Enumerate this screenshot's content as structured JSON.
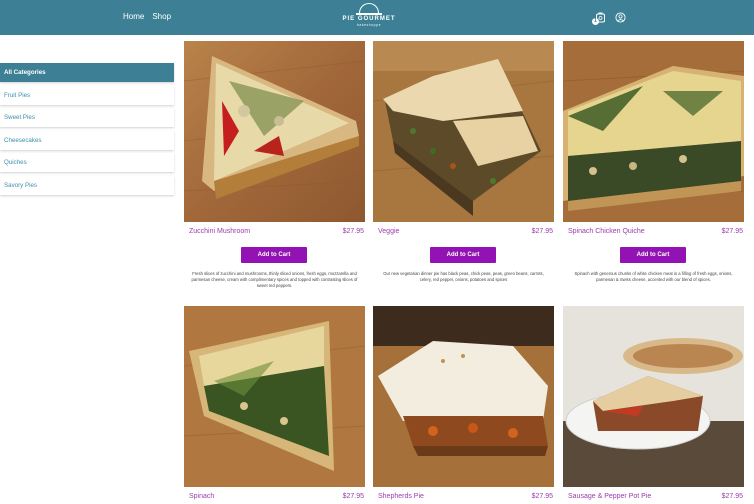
{
  "header": {
    "nav": [
      "Home",
      "Shop"
    ],
    "brand": "PIE GOURMET",
    "brand_sub": "bakeshoppe",
    "cart_count": "1"
  },
  "sidebar": {
    "categories": [
      {
        "label": "All Categories",
        "active": true
      },
      {
        "label": "Fruit Pies",
        "active": false
      },
      {
        "label": "Sweet Pies",
        "active": false
      },
      {
        "label": "Cheesecakes",
        "active": false
      },
      {
        "label": "Quiches",
        "active": false
      },
      {
        "label": "Savory Pies",
        "active": false
      }
    ]
  },
  "products": [
    {
      "name": "Zucchini Mushroom",
      "price": "$27.95",
      "button": "Add to Cart",
      "description": "Fresh slices of zucchini and mushrooms, thinly sliced onions, fresh eggs, mozzarella and parmesan cheese, cream with complimentary spices and topped with contrasting slices of sweet red peppers."
    },
    {
      "name": "Veggie",
      "price": "$27.95",
      "button": "Add to Cart",
      "description": "Our new vegetarian dinner pie has black peas, chick peas, peas, green beans, carrots, celery, red pepper, onions, potatoes and spices"
    },
    {
      "name": "Spinach Chicken Quiche",
      "price": "$27.95",
      "button": "Add to Cart",
      "description": "Spinach with generous chunks of white chicken meat in a filling of fresh eggs, onions, parmesan & Swiss cheese, accented with our blend of spices."
    },
    {
      "name": "Spinach",
      "price": "$27.95",
      "button": "Add to Cart",
      "description": ""
    },
    {
      "name": "Shepherds Pie",
      "price": "$27.95",
      "button": "Add to Cart",
      "description": ""
    },
    {
      "name": "Sausage & Pepper Pot Pie",
      "price": "$27.95",
      "button": "Add to Cart",
      "description": ""
    }
  ],
  "colors": {
    "header": "#3d8096",
    "accent": "#9312b3",
    "title": "#9b3dab",
    "category_text": "#3d8fa9"
  }
}
